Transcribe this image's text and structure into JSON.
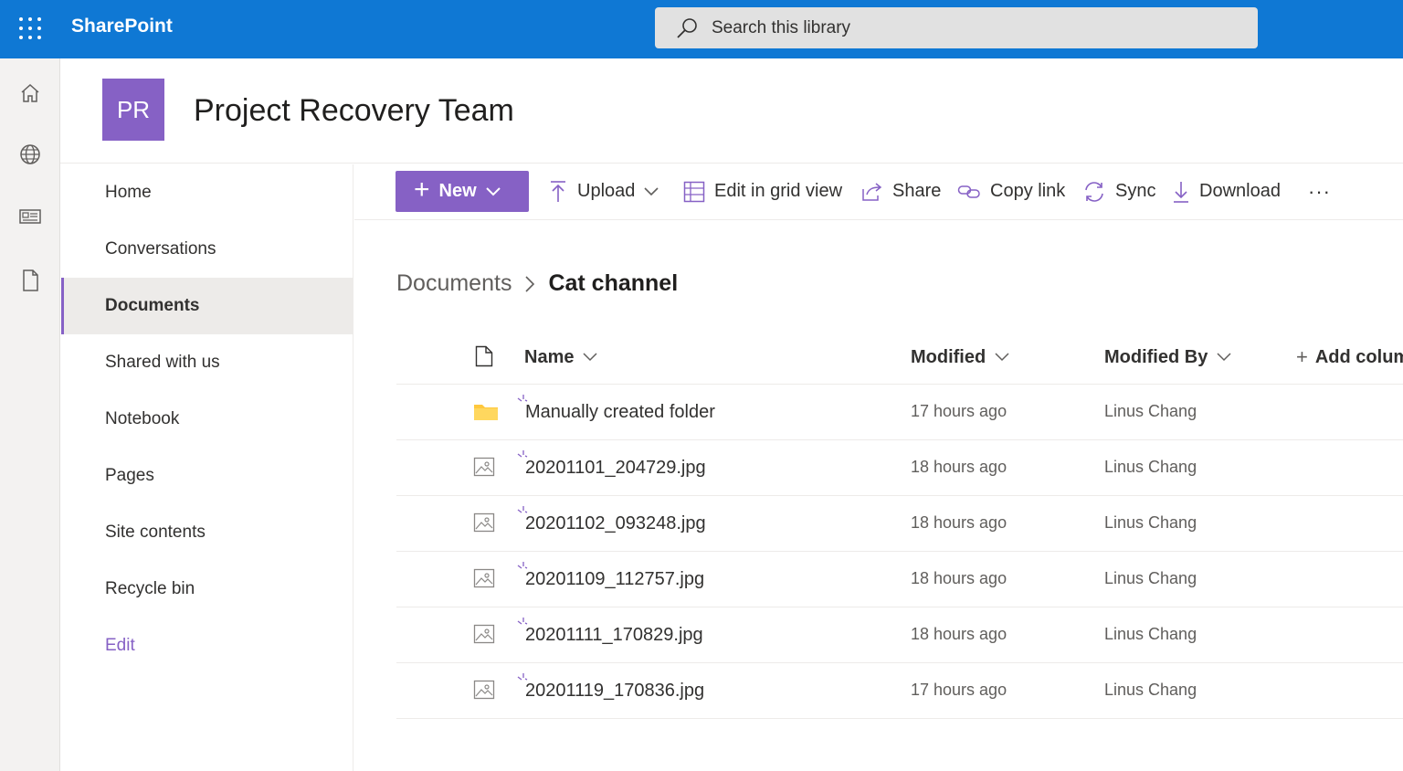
{
  "topbar": {
    "app_name": "SharePoint",
    "search_placeholder": "Search this library"
  },
  "site": {
    "logo_initials": "PR",
    "title": "Project Recovery Team"
  },
  "leftnav": {
    "items": [
      {
        "label": "Home"
      },
      {
        "label": "Conversations"
      },
      {
        "label": "Documents",
        "active": true
      },
      {
        "label": "Shared with us"
      },
      {
        "label": "Notebook"
      },
      {
        "label": "Pages"
      },
      {
        "label": "Site contents"
      },
      {
        "label": "Recycle bin"
      }
    ],
    "edit_label": "Edit"
  },
  "commandbar": {
    "new_label": "New",
    "upload_label": "Upload",
    "grid_label": "Edit in grid view",
    "share_label": "Share",
    "copylink_label": "Copy link",
    "sync_label": "Sync",
    "download_label": "Download",
    "more_label": "···"
  },
  "breadcrumb": {
    "root": "Documents",
    "separator": ">",
    "current": "Cat channel"
  },
  "table": {
    "columns": {
      "name": "Name",
      "modified": "Modified",
      "modified_by": "Modified By",
      "add_column": "Add colum"
    },
    "rows": [
      {
        "name": "Manually created folder",
        "type": "folder",
        "modified": "17 hours ago",
        "modified_by": "Linus Chang"
      },
      {
        "name": "20201101_204729.jpg",
        "type": "image",
        "modified": "18 hours ago",
        "modified_by": "Linus Chang"
      },
      {
        "name": "20201102_093248.jpg",
        "type": "image",
        "modified": "18 hours ago",
        "modified_by": "Linus Chang"
      },
      {
        "name": "20201109_112757.jpg",
        "type": "image",
        "modified": "18 hours ago",
        "modified_by": "Linus Chang"
      },
      {
        "name": "20201111_170829.jpg",
        "type": "image",
        "modified": "18 hours ago",
        "modified_by": "Linus Chang"
      },
      {
        "name": "20201119_170836.jpg",
        "type": "image",
        "modified": "17 hours ago",
        "modified_by": "Linus Chang"
      }
    ]
  },
  "colors": {
    "suite_bar": "#0f78d4",
    "accent": "#8661c5",
    "folder": "#ffc83d"
  }
}
